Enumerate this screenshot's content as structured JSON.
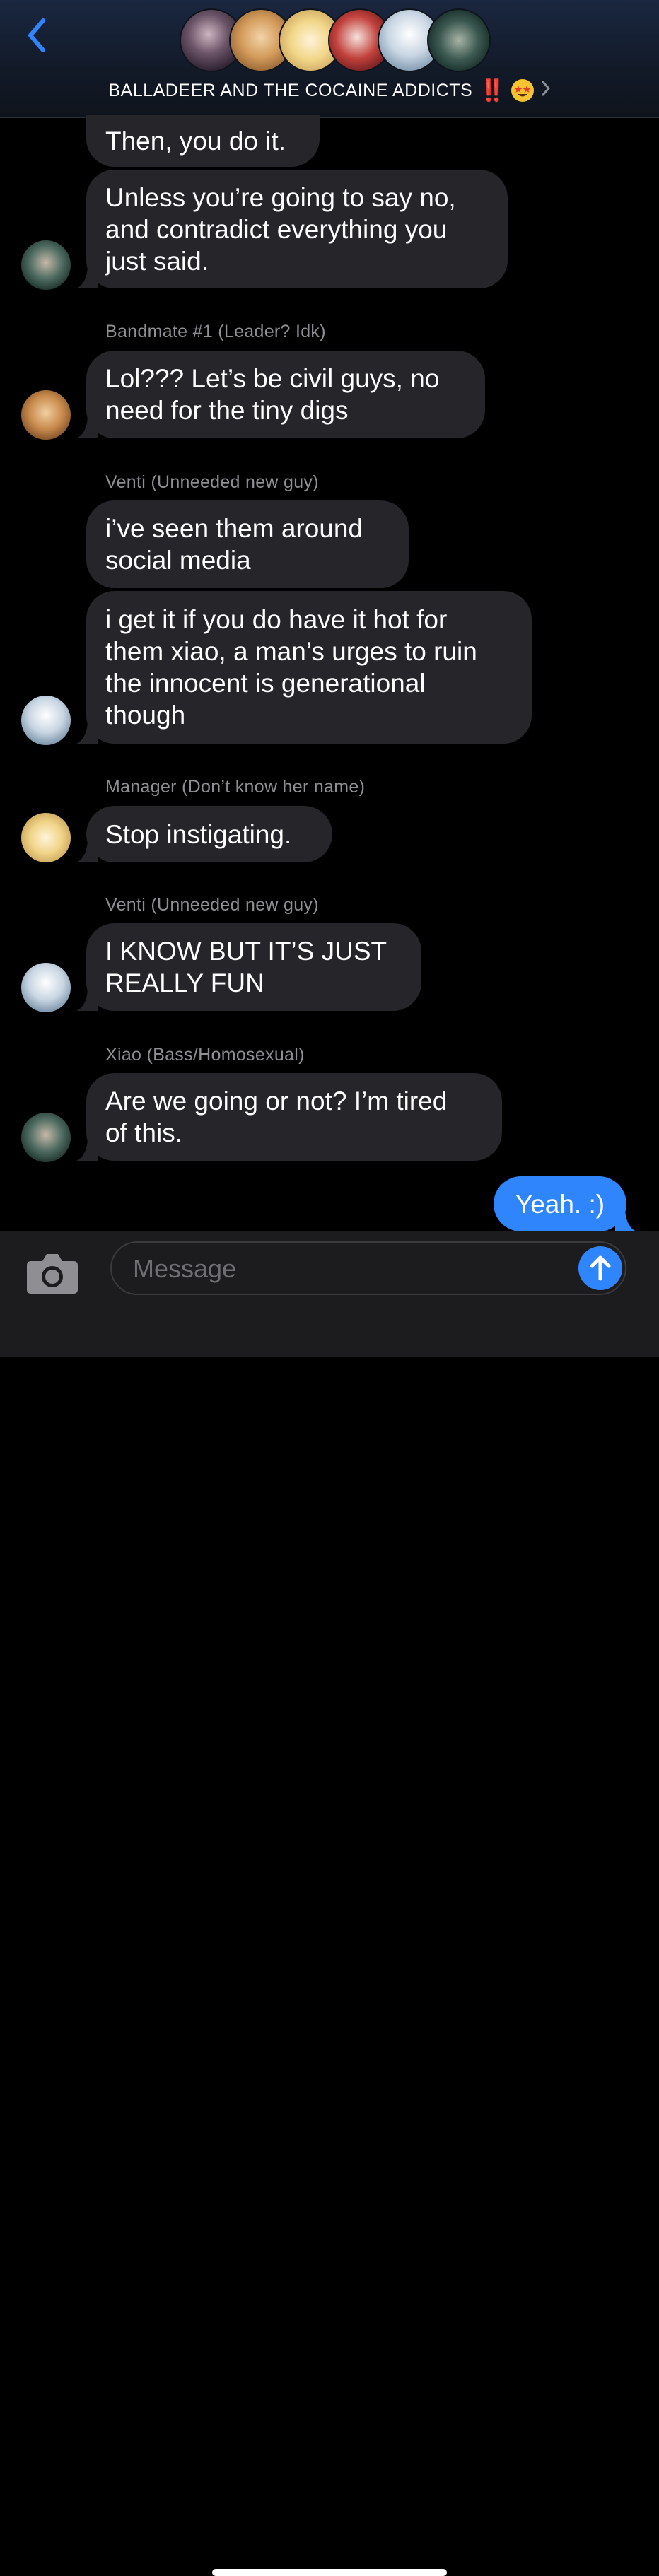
{
  "header": {
    "title": "BALLADEER AND THE COCAINE ADDICTS",
    "title_marks": "‼️",
    "back_icon": "chevron-left-icon",
    "detail_icon": "chevron-right-icon"
  },
  "messages": [
    {
      "sender": "",
      "text": "Then, you do it."
    },
    {
      "sender": "",
      "text": "Unless you’re going to say no,\nand contradict everything you\njust said."
    },
    {
      "sender": "Bandmate #1 (Leader? Idk)",
      "text": "Lol??? Let’s be civil guys, no\nneed for the tiny digs"
    },
    {
      "sender": "Venti (Unneeded new guy)",
      "text": "i’ve seen them around\nsocial media"
    },
    {
      "sender": "",
      "text": "i get it if you do have it hot for\nthem xiao, a man’s urges to ruin\nthe innocent is generational\nthough"
    },
    {
      "sender": "Manager (Don’t know her name)",
      "text": "Stop instigating."
    },
    {
      "sender": "Venti (Unneeded new guy)",
      "text": "I KNOW BUT IT’S JUST\nREALLY FUN"
    },
    {
      "sender": "Xiao (Bass/Homosexual)",
      "text": "Are we going or not? I’m tired\nof this."
    },
    {
      "sender": "",
      "text": "Yeah. :)"
    }
  ],
  "input": {
    "placeholder": "Message",
    "camera_icon": "camera-icon",
    "send_icon": "arrow-up-icon"
  },
  "colors": {
    "incoming_bubble": "#26252a",
    "outgoing_bubble": "#2f85fb",
    "accent": "#2f85fb"
  }
}
